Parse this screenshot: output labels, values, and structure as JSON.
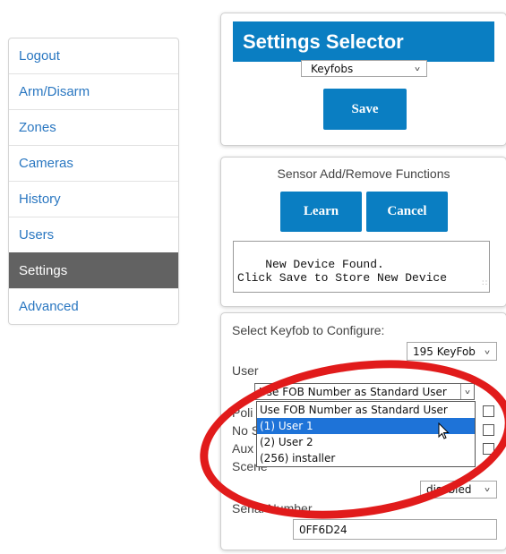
{
  "sidebar": {
    "items": [
      {
        "label": "Logout"
      },
      {
        "label": "Arm/Disarm"
      },
      {
        "label": "Zones"
      },
      {
        "label": "Cameras"
      },
      {
        "label": "History"
      },
      {
        "label": "Users"
      },
      {
        "label": "Settings",
        "active": true
      },
      {
        "label": "Advanced"
      }
    ]
  },
  "settings_selector": {
    "title": "Settings Selector",
    "selected": "Keyfobs",
    "save_label": "Save"
  },
  "sensor_panel": {
    "heading": "Sensor Add/Remove Functions",
    "learn_label": "Learn",
    "cancel_label": "Cancel",
    "message": "New Device Found.\nClick Save to Store New Device"
  },
  "keyfob_panel": {
    "select_label": "Select Keyfob to Configure:",
    "keyfob_selected": "195 KeyFob",
    "user_label": "User",
    "user_selected": "Use FOB Number as Standard User",
    "options": [
      {
        "label": "Use FOB Number as Standard User"
      },
      {
        "label": "(1) User 1",
        "highlighted": true
      },
      {
        "label": "(2) User 2"
      },
      {
        "label": "(256) installer"
      }
    ],
    "row_fragments": [
      "Poli",
      "No S",
      "Aux",
      "Scene"
    ],
    "scene_value": "disabled",
    "serial_label": "Serial Number",
    "serial_value": "0FF6D24"
  },
  "colors": {
    "accent": "#0a7ec2",
    "sidebar_active": "#626262",
    "link": "#2a77c1",
    "highlight": "#1e73d8",
    "annotation": "#e11b1b"
  },
  "icons": {
    "chevron": "chevron-down-icon",
    "cursor": "mouse-pointer-icon",
    "resize": "resize-grip-icon"
  }
}
